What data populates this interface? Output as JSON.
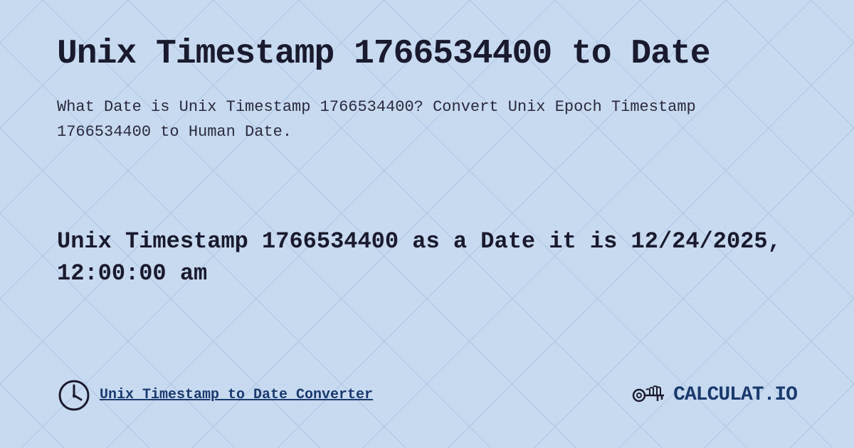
{
  "background": {
    "color": "#c8daf0",
    "pattern": "diamond"
  },
  "header": {
    "title": "Unix Timestamp 1766534400 to Date"
  },
  "description": {
    "text": "What Date is Unix Timestamp 1766534400? Convert Unix Epoch Timestamp 1766534400 to Human Date."
  },
  "result": {
    "text": "Unix Timestamp 1766534400 as a Date it is 12/24/2025, 12:00:00 am"
  },
  "footer": {
    "link_label": "Unix Timestamp to Date Converter",
    "logo_text": "CALCULAT.IO"
  }
}
